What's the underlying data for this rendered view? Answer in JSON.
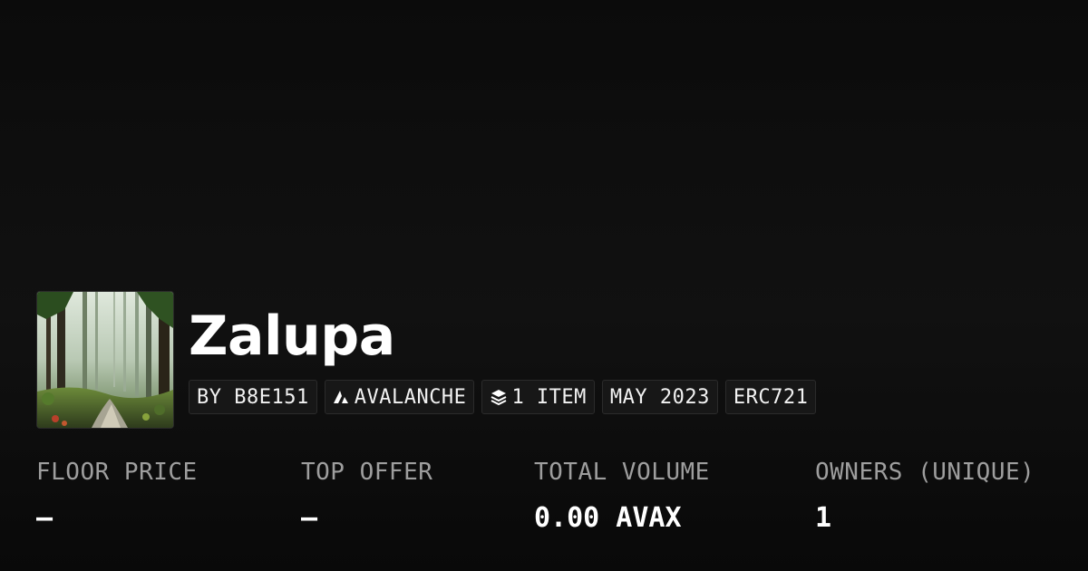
{
  "collection": {
    "name": "Zalupa",
    "thumbnail_icon": "forest-thumbnail",
    "badges": {
      "creator": "BY B8E151",
      "chain": "AVALANCHE",
      "items": "1 ITEM",
      "date": "MAY 2023",
      "standard": "ERC721"
    },
    "icons": {
      "chain": "avalanche-logo-icon",
      "items": "layers-icon"
    }
  },
  "stats": {
    "floor_price": {
      "label": "FLOOR PRICE",
      "value": "–"
    },
    "top_offer": {
      "label": "TOP OFFER",
      "value": "–"
    },
    "total_volume": {
      "label": "TOTAL VOLUME",
      "value": "0.00 AVAX"
    },
    "owners": {
      "label": "OWNERS (UNIQUE)",
      "value": "1"
    }
  },
  "colors": {
    "background": "#0b0b0b",
    "badge_bg": "#171717",
    "label": "#9e9e9e",
    "value": "#ffffff"
  }
}
